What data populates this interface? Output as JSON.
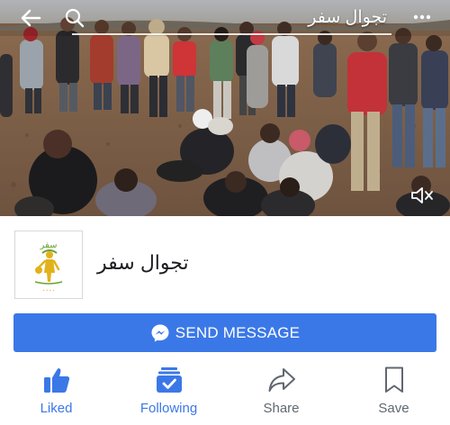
{
  "header": {
    "title": "تجوال سفر"
  },
  "page": {
    "name": "تجوال سفر",
    "logo_text": "سفر"
  },
  "send_message": {
    "label": "SEND MESSAGE"
  },
  "actions": [
    {
      "label": "Liked",
      "icon": "thumbs-up-icon",
      "state": "active"
    },
    {
      "label": "Following",
      "icon": "following-icon",
      "state": "active"
    },
    {
      "label": "Share",
      "icon": "share-icon",
      "state": "inactive"
    },
    {
      "label": "Save",
      "icon": "bookmark-icon",
      "state": "inactive"
    }
  ],
  "colors": {
    "accent": "#3b78e7",
    "inactive": "#606770",
    "logo_yellow": "#e2b21c",
    "logo_green": "#6aa12f"
  }
}
